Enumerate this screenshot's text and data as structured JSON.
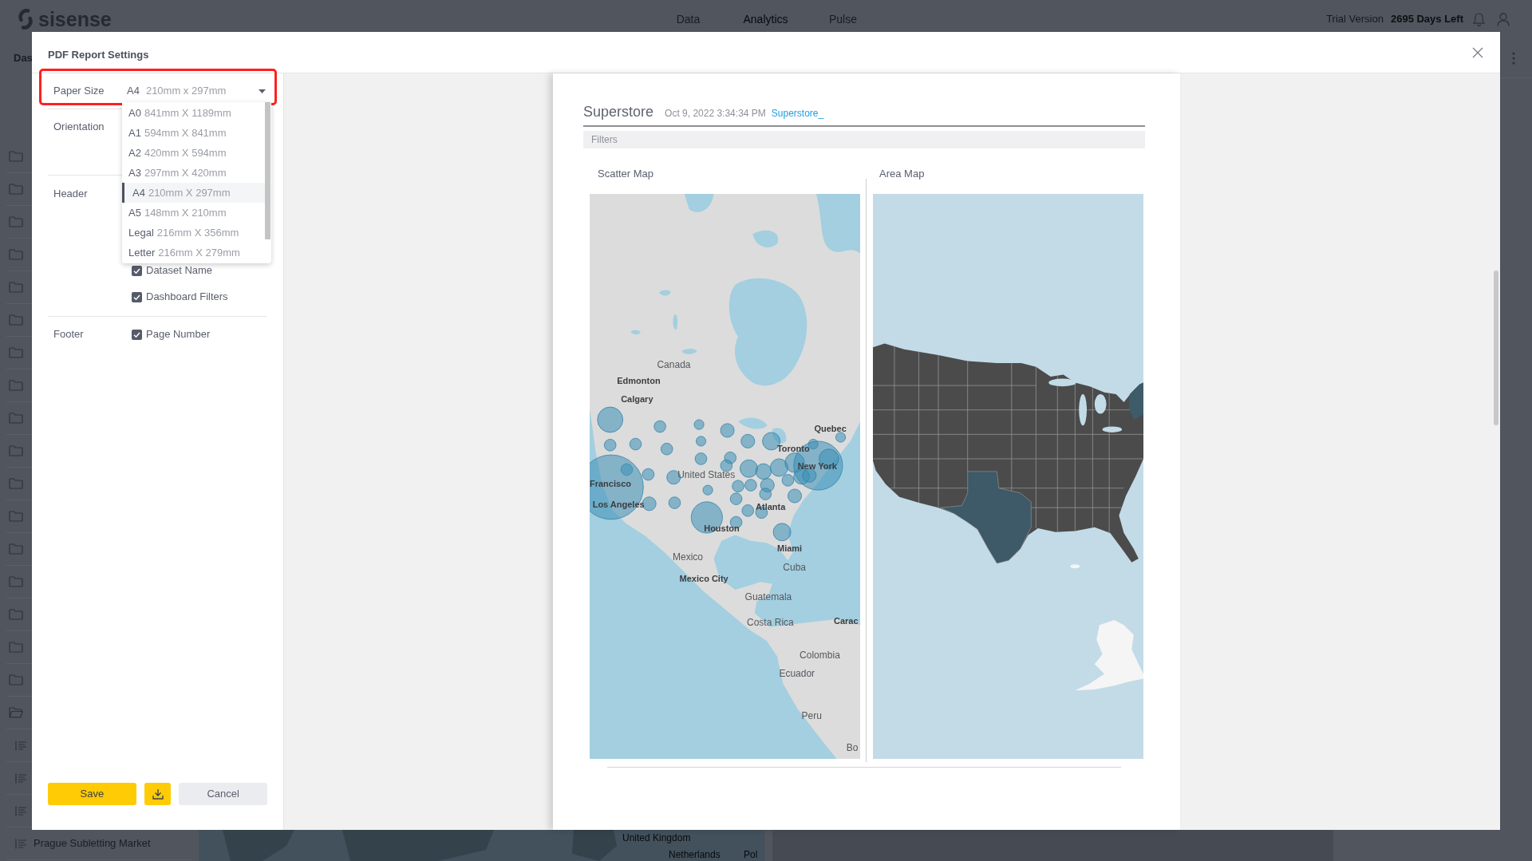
{
  "app_bar": {
    "logo": "sisense",
    "nav": [
      {
        "label": "Data",
        "selected": false
      },
      {
        "label": "Analytics",
        "selected": true
      },
      {
        "label": "Pulse",
        "selected": false
      }
    ],
    "trial_label": "Trial Version",
    "days_left": "2695 Days Left"
  },
  "sidebar": {
    "header": "Das",
    "items": [
      {
        "kind": "folder",
        "expanded": false
      },
      {
        "kind": "folder",
        "expanded": false
      },
      {
        "kind": "folder",
        "expanded": false
      },
      {
        "kind": "folder",
        "expanded": false
      },
      {
        "kind": "folder",
        "expanded": false
      },
      {
        "kind": "folder",
        "expanded": false
      },
      {
        "kind": "folder",
        "expanded": false
      },
      {
        "kind": "folder",
        "expanded": false
      },
      {
        "kind": "folder",
        "expanded": false
      },
      {
        "kind": "folder",
        "expanded": false
      },
      {
        "kind": "folder",
        "expanded": false
      },
      {
        "kind": "folder",
        "expanded": false
      },
      {
        "kind": "folder",
        "expanded": false
      },
      {
        "kind": "folder",
        "expanded": false
      },
      {
        "kind": "folder",
        "expanded": false
      },
      {
        "kind": "folder",
        "expanded": false
      },
      {
        "kind": "folder",
        "expanded": false
      },
      {
        "kind": "folder",
        "expanded": true,
        "children": [
          {
            "kind": "dashboard"
          },
          {
            "kind": "dashboard"
          },
          {
            "kind": "dashboard"
          },
          {
            "kind": "dashboard",
            "label": "Prague Subletting Market"
          }
        ]
      }
    ]
  },
  "dashboard_background": {
    "map_labels": [
      "United Kingdom",
      "Netherlands",
      "Pol"
    ]
  },
  "dialog": {
    "title": "PDF Report Settings",
    "paper_size": {
      "label": "Paper Size",
      "size": "A4",
      "dimensions": "210mm x 297mm",
      "highlighted": true,
      "expanded": true,
      "options": [
        {
          "size": "A0",
          "dimensions": "841mm X 1189mm",
          "selected": false
        },
        {
          "size": "A1",
          "dimensions": "594mm X 841mm",
          "selected": false
        },
        {
          "size": "A2",
          "dimensions": "420mm X 594mm",
          "selected": false
        },
        {
          "size": "A3",
          "dimensions": "297mm X 420mm",
          "selected": false
        },
        {
          "size": "A4",
          "dimensions": "210mm X 297mm",
          "selected": true
        },
        {
          "size": "A5",
          "dimensions": "148mm X 210mm",
          "selected": false
        },
        {
          "size": "Legal",
          "dimensions": "216mm X 356mm",
          "selected": false
        },
        {
          "size": "Letter",
          "dimensions": "216mm X 279mm",
          "selected": false
        }
      ]
    },
    "orientation": {
      "label": "Orientation"
    },
    "header": {
      "label": "Header",
      "options": [
        {
          "label": "Dataset Name",
          "checked": true
        },
        {
          "label": "Dashboard Filters",
          "checked": true
        }
      ]
    },
    "footer": {
      "label": "Footer",
      "options": [
        {
          "label": "Page Number",
          "checked": true
        }
      ]
    },
    "buttons": {
      "save": "Save",
      "cancel": "Cancel"
    },
    "preview": {
      "title": "Superstore",
      "timestamp": "Oct 9, 2022 3:34:34 PM",
      "link": "Superstore_",
      "filters_label": "Filters",
      "widgets": [
        {
          "kind": "scatter_map",
          "title": "Scatter Map",
          "labels": [
            {
              "text": "Canada",
              "kind": "country"
            },
            {
              "text": "Edmonton",
              "kind": "city"
            },
            {
              "text": "Calgary",
              "kind": "city"
            },
            {
              "text": "Quebec",
              "kind": "city"
            },
            {
              "text": "Toronto",
              "kind": "city"
            },
            {
              "text": "United States",
              "kind": "country"
            },
            {
              "text": "New York",
              "kind": "city"
            },
            {
              "text": "Francisco",
              "kind": "city"
            },
            {
              "text": "Los Angeles",
              "kind": "city"
            },
            {
              "text": "Atlanta",
              "kind": "city"
            },
            {
              "text": "Houston",
              "kind": "city"
            },
            {
              "text": "Miami",
              "kind": "city"
            },
            {
              "text": "Mexico",
              "kind": "country"
            },
            {
              "text": "Cuba",
              "kind": "country"
            },
            {
              "text": "Mexico City",
              "kind": "city"
            },
            {
              "text": "Guatemala",
              "kind": "country"
            },
            {
              "text": "Costa Rica",
              "kind": "country"
            },
            {
              "text": "Carac",
              "kind": "city"
            },
            {
              "text": "Colombia",
              "kind": "country"
            },
            {
              "text": "Ecuador",
              "kind": "country"
            },
            {
              "text": "Peru",
              "kind": "country"
            },
            {
              "text": "Bo",
              "kind": "country"
            }
          ]
        },
        {
          "kind": "area_map",
          "title": "Area Map"
        }
      ]
    }
  }
}
